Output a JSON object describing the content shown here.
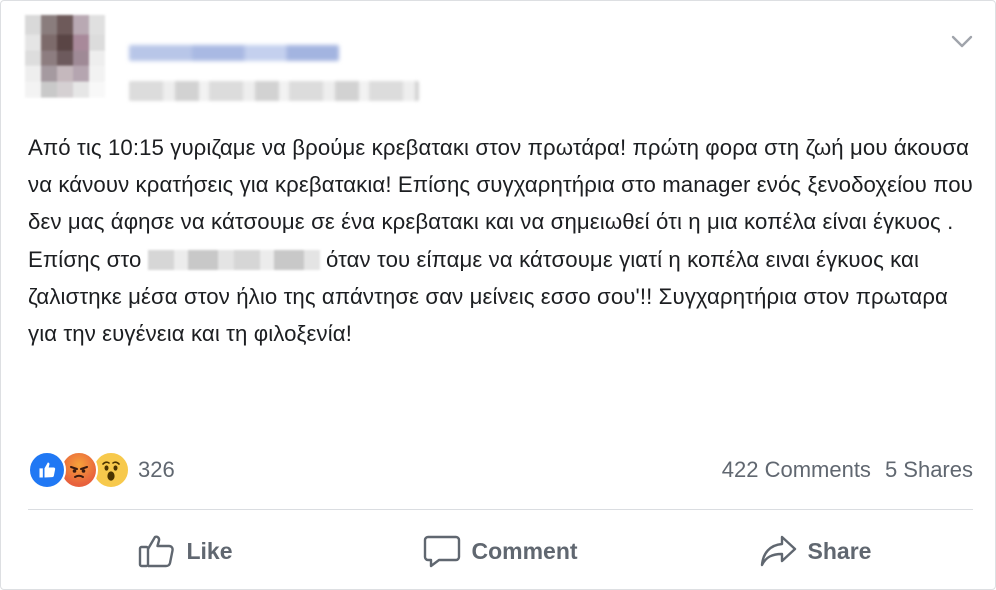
{
  "post": {
    "text_segments": {
      "before_redaction": "Από τις 10:15 γυριζαμε να βρούμε κρεβατακι στον πρωτάρα! πρώτη φορα στη ζωή μου άκουσα να κάνουν κρατήσεις για κρεβατακια! Επίσης συγχαρητήρια στο manager ενός ξενοδοχείου που δεν μας άφησε να κάτσουμε σε ένα κρεβατακι και να σημειωθεί ότι η μια κοπέλα είναι έγκυος . Επίσης στο",
      "after_redaction": "όταν του είπαμε να κάτσουμε γιατί η κοπέλα ειναι έγκυος και ζαλιστηκε μέσα στον ήλιο της απάντησε σαν μείνεις εσσο σου'!! Συγχαρητήρια στον πρωταρα για την ευγένεια και τη φιλοξενία!"
    }
  },
  "reactions": {
    "icons": [
      "like-icon",
      "angry-icon",
      "wow-icon"
    ],
    "count": "326"
  },
  "stats": {
    "comments": "422 Comments",
    "shares": "5 Shares"
  },
  "actions": {
    "like_label": "Like",
    "comment_label": "Comment",
    "share_label": "Share"
  },
  "colors": {
    "like_blue": "#2078f4",
    "secondary_text": "#606770",
    "primary_text": "#1c1e21"
  }
}
